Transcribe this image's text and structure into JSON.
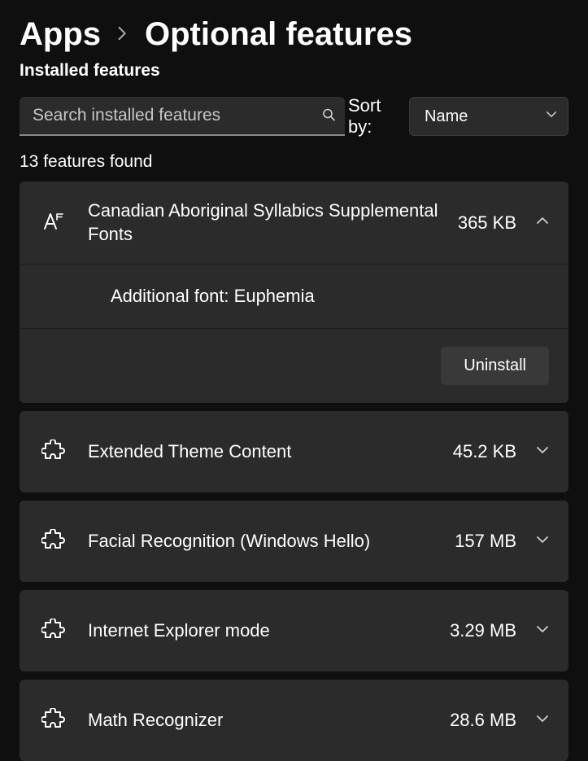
{
  "breadcrumb": {
    "root": "Apps",
    "current": "Optional features"
  },
  "section_title": "Installed features",
  "search": {
    "placeholder": "Search installed features"
  },
  "sort": {
    "label": "Sort by:",
    "value": "Name"
  },
  "count_text": "13 features found",
  "uninstall_label": "Uninstall",
  "items": [
    {
      "title": "Canadian Aboriginal Syllabics Supplemental Fonts",
      "size": "365 KB",
      "icon": "font",
      "expanded": true,
      "detail": "Additional font: Euphemia"
    },
    {
      "title": "Extended Theme Content",
      "size": "45.2 KB",
      "icon": "puzzle",
      "expanded": false
    },
    {
      "title": "Facial Recognition (Windows Hello)",
      "size": "157 MB",
      "icon": "puzzle",
      "expanded": false
    },
    {
      "title": "Internet Explorer mode",
      "size": "3.29 MB",
      "icon": "puzzle",
      "expanded": false
    },
    {
      "title": "Math Recognizer",
      "size": "28.6 MB",
      "icon": "puzzle",
      "expanded": false
    }
  ]
}
